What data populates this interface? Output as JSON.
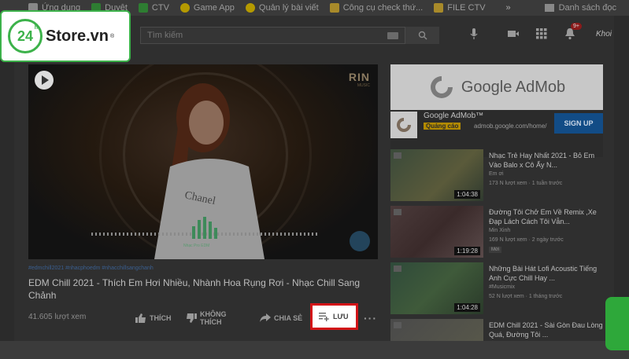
{
  "bookmarks": {
    "items": [
      "Ứng dụng",
      "Duyệt",
      "CTV",
      "Game App",
      "Quản lý bài viết",
      "Công cụ check thứ...",
      "FILE CTV"
    ],
    "more": "»",
    "reading_list": "Danh sách đọc"
  },
  "logo": {
    "number": "24",
    "hours": "h",
    "name": "Store.vn",
    "reg": "®"
  },
  "header": {
    "search_placeholder": "Tìm kiếm",
    "notif_count": "9+",
    "avatar": "Khoi"
  },
  "player": {
    "channel_logo": "RIN",
    "channel_sub": "MUSIC",
    "eq_label": "Nhạc Pro EDM"
  },
  "video": {
    "hashtags": "#edmchill2021 #nhacphoedm #nhacchillsangchanh",
    "title": "EDM Chill 2021 - Thích Em Hơi Nhiều, Nhành Hoa Rụng Rơi - Nhạc Chill Sang Chảnh",
    "views": "41.605 lượt xem",
    "actions": {
      "like": "THÍCH",
      "dislike": "KHÔNG THÍCH",
      "share": "CHIA SẺ",
      "save": "LƯU",
      "more": "···"
    }
  },
  "ad": {
    "brand": "Google AdMob",
    "name": "Google AdMob™",
    "badge": "Quảng cáo",
    "domain": "admob.google.com/home/",
    "signup": "SIGN UP"
  },
  "related": [
    {
      "title": "Nhạc Trẻ Hay Nhất 2021 - Bỏ Em Vào Balo x Cô Ấy N...",
      "channel": "Em ơi",
      "meta": "173 N lượt xem · 1 tuần trước",
      "duration": "1:04:38",
      "badge": ""
    },
    {
      "title": "Đường Tôi Chở Em Về Remix ,Xe Đạp Lách Cách Tôi Vẫn...",
      "channel": "Min Xinh",
      "meta": "169 N lượt xem · 2 ngày trước",
      "duration": "1:19:28",
      "badge": "Mới"
    },
    {
      "title": "Những Bài Hát Lofi Acoustic Tiếng Anh Cực Chill Hay ...",
      "channel": "#Musicmix",
      "meta": "52 N lượt xem · 1 tháng trước",
      "duration": "1:04:28",
      "badge": ""
    },
    {
      "title": "EDM Chill 2021 - Sài Gòn Đau Lòng Quá, Đường Tôi ...",
      "channel": "",
      "meta": "",
      "duration": "",
      "badge": ""
    }
  ]
}
